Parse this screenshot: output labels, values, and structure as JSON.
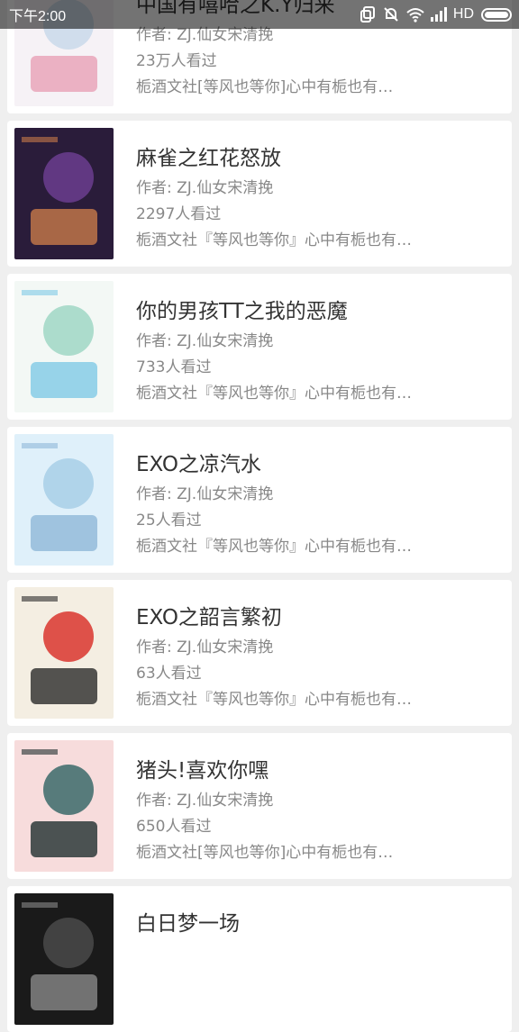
{
  "status_bar": {
    "time": "下午2:00",
    "network_label": "HD",
    "battery_level": 1.0,
    "icons": [
      "copy-icon",
      "mute-icon",
      "wifi-icon",
      "signal-icon",
      "battery-icon"
    ]
  },
  "books": [
    {
      "title": "中国有嘻哈之K.Y归来",
      "author": "作者: ZJ.仙女宋清挽",
      "views": "23万人看过",
      "description": "栀酒文社[等风也等你]心中有栀也有…",
      "cover_colors": [
        "#f6f2f6",
        "#c9d9ea",
        "#e9a0b6"
      ]
    },
    {
      "title": "麻雀之红花怒放",
      "author": "作者: ZJ.仙女宋清挽",
      "views": "2297人看过",
      "description": "栀酒文社『等风也等你』心中有栀也有…",
      "cover_colors": [
        "#2a1c3a",
        "#6b3d8f",
        "#c87a4a"
      ]
    },
    {
      "title": "你的男孩TT之我的恶魔",
      "author": "作者: ZJ.仙女宋清挽",
      "views": "733人看过",
      "description": "栀酒文社『等风也等你』心中有栀也有…",
      "cover_colors": [
        "#f3f8f5",
        "#9fd7c4",
        "#7fc9e6"
      ]
    },
    {
      "title": "EXO之凉汽水",
      "author": "作者: ZJ.仙女宋清挽",
      "views": "25人看过",
      "description": "栀酒文社『等风也等你』心中有栀也有…",
      "cover_colors": [
        "#dff0fa",
        "#a8cfe6",
        "#8fb8d8"
      ]
    },
    {
      "title": "EXO之韶言繁初",
      "author": "作者: ZJ.仙女宋清挽",
      "views": "63人看过",
      "description": "栀酒文社『等风也等你』心中有栀也有…",
      "cover_colors": [
        "#f4eee2",
        "#d9352e",
        "#2b2b2b"
      ]
    },
    {
      "title": "猪头!喜欢你嘿",
      "author": "作者: ZJ.仙女宋清挽",
      "views": "650人看过",
      "description": "栀酒文社[等风也等你]心中有栀也有…",
      "cover_colors": [
        "#f7dcdc",
        "#3b6a6a",
        "#1f2f2f"
      ]
    },
    {
      "title": "白日梦一场",
      "author": "",
      "views": "",
      "description": "",
      "cover_colors": [
        "#1a1a1a",
        "#4a4a4a",
        "#888888"
      ]
    }
  ]
}
